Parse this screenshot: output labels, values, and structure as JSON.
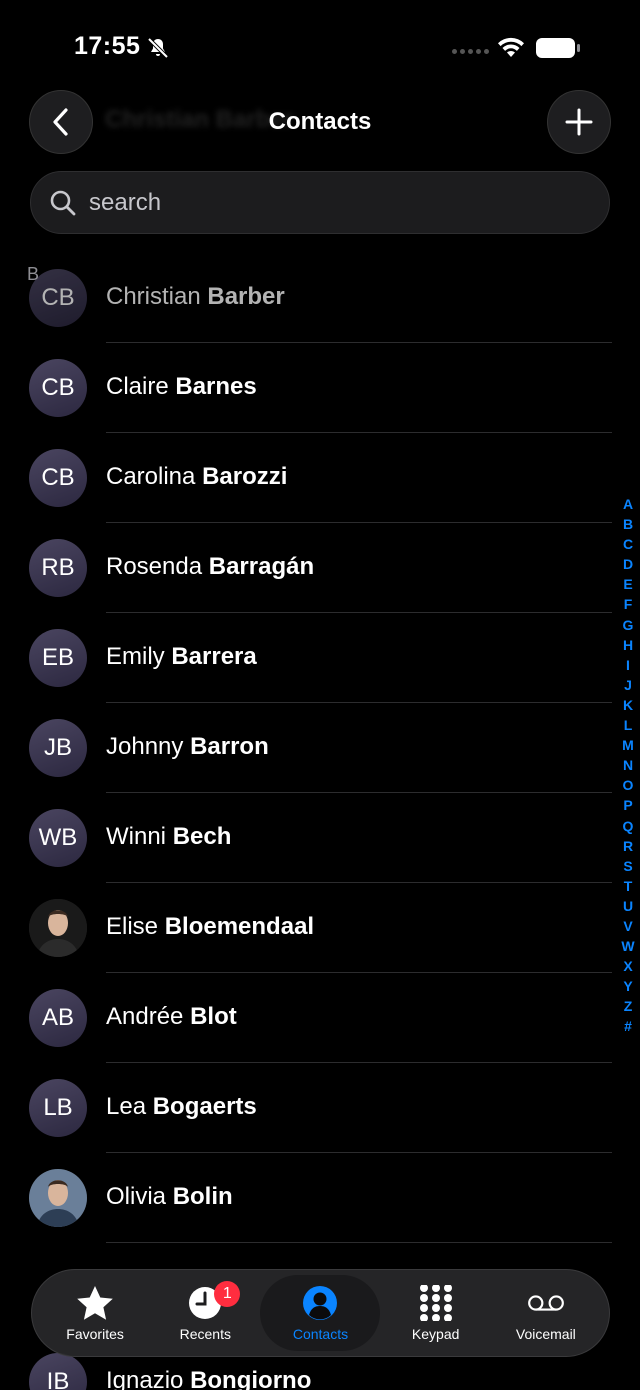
{
  "status": {
    "time": "17:55"
  },
  "nav": {
    "title": "Contacts"
  },
  "search": {
    "placeholder": "search"
  },
  "section": "B",
  "contacts": [
    {
      "initials": "CB",
      "first": "Christian",
      "last": "Barber",
      "photo": false
    },
    {
      "initials": "CB",
      "first": "Claire",
      "last": "Barnes",
      "photo": false
    },
    {
      "initials": "CB",
      "first": "Carolina",
      "last": "Barozzi",
      "photo": false
    },
    {
      "initials": "RB",
      "first": "Rosenda",
      "last": "Barragán",
      "photo": false
    },
    {
      "initials": "EB",
      "first": "Emily",
      "last": "Barrera",
      "photo": false
    },
    {
      "initials": "JB",
      "first": "Johnny",
      "last": "Barron",
      "photo": false
    },
    {
      "initials": "WB",
      "first": "Winni",
      "last": "Bech",
      "photo": false
    },
    {
      "initials": "",
      "first": "Elise",
      "last": "Bloemendaal",
      "photo": true
    },
    {
      "initials": "AB",
      "first": "Andrée",
      "last": "Blot",
      "photo": false
    },
    {
      "initials": "LB",
      "first": "Lea",
      "last": "Bogaerts",
      "photo": false
    },
    {
      "initials": "",
      "first": "Olivia",
      "last": "Bolin",
      "photo": true
    }
  ],
  "peek": {
    "initials": "IB",
    "first": "Ignazio",
    "last": "Bongiorno"
  },
  "index_letters": [
    "A",
    "B",
    "C",
    "D",
    "E",
    "F",
    "G",
    "H",
    "I",
    "J",
    "K",
    "L",
    "M",
    "N",
    "O",
    "P",
    "Q",
    "R",
    "S",
    "T",
    "U",
    "V",
    "W",
    "X",
    "Y",
    "Z",
    "#"
  ],
  "tabs": [
    {
      "label": "Favorites",
      "icon": "star-icon",
      "active": false,
      "badge": ""
    },
    {
      "label": "Recents",
      "icon": "clock-icon",
      "active": false,
      "badge": "1"
    },
    {
      "label": "Contacts",
      "icon": "person-circle-icon",
      "active": true,
      "badge": ""
    },
    {
      "label": "Keypad",
      "icon": "keypad-icon",
      "active": false,
      "badge": ""
    },
    {
      "label": "Voicemail",
      "icon": "voicemail-icon",
      "active": false,
      "badge": ""
    }
  ],
  "colors": {
    "accent": "#0a84ff",
    "badge": "#ff2d3f",
    "avatar": "#3a3550"
  }
}
